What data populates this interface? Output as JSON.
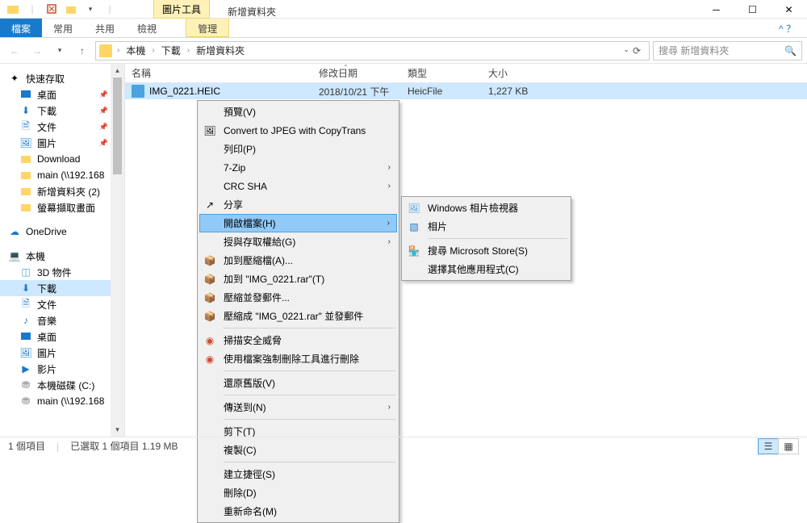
{
  "window": {
    "tools_tab": "圖片工具",
    "title": "新增資料夾"
  },
  "ribbon": {
    "file": "檔案",
    "home": "常用",
    "share": "共用",
    "view": "檢視",
    "manage": "管理"
  },
  "breadcrumb": {
    "pc": "本機",
    "downloads": "下載",
    "folder": "新增資料夾"
  },
  "search": {
    "placeholder": "搜尋 新增資料夾"
  },
  "nav": {
    "quick": "快速存取",
    "desktop": "桌面",
    "downloads": "下載",
    "documents": "文件",
    "pictures": "圖片",
    "download_en": "Download",
    "main192": "main (\\\\192.168",
    "newfolder2": "新增資料夾 (2)",
    "screenshots": "螢幕擷取畫面",
    "onedrive": "OneDrive",
    "thispc": "本機",
    "objects3d": "3D 物件",
    "downloads2": "下載",
    "documents2": "文件",
    "music": "音樂",
    "desktop2": "桌面",
    "pictures2": "圖片",
    "videos": "影片",
    "localdisk": "本機磁碟 (C:)",
    "main192b": "main (\\\\192.168"
  },
  "columns": {
    "name": "名稱",
    "date": "修改日期",
    "type": "類型",
    "size": "大小"
  },
  "file": {
    "name": "IMG_0221.HEIC",
    "date": "2018/10/21 下午",
    "type": "HeicFile",
    "size": "1,227 KB"
  },
  "ctx": {
    "preview": "預覽(V)",
    "convert": "Convert to JPEG with CopyTrans",
    "print": "列印(P)",
    "sevenzip": "7-Zip",
    "crcsha": "CRC SHA",
    "share": "分享",
    "openwith": "開啟檔案(H)",
    "grantaccess": "授與存取權給(G)",
    "addarchive": "加到壓縮檔(A)...",
    "addrar": "加到 \"IMG_0221.rar\"(T)",
    "compressemail": "壓縮並發郵件...",
    "compressraremail": "壓縮成 \"IMG_0221.rar\" 並發郵件",
    "scanvirus": "掃描安全威脅",
    "forcedelete": "使用檔案強制刪除工具進行刪除",
    "restoreprev": "還原舊版(V)",
    "sendto": "傳送到(N)",
    "cut": "剪下(T)",
    "copy": "複製(C)",
    "shortcut": "建立捷徑(S)",
    "delete": "刪除(D)",
    "rename": "重新命名(M)"
  },
  "sub": {
    "winphoto": "Windows 相片檢視器",
    "photos": "相片",
    "msstore": "搜尋 Microsoft Store(S)",
    "chooseapp": "選擇其他應用程式(C)"
  },
  "status": {
    "items": "1 個項目",
    "selected": "已選取 1 個項目  1.19 MB"
  }
}
